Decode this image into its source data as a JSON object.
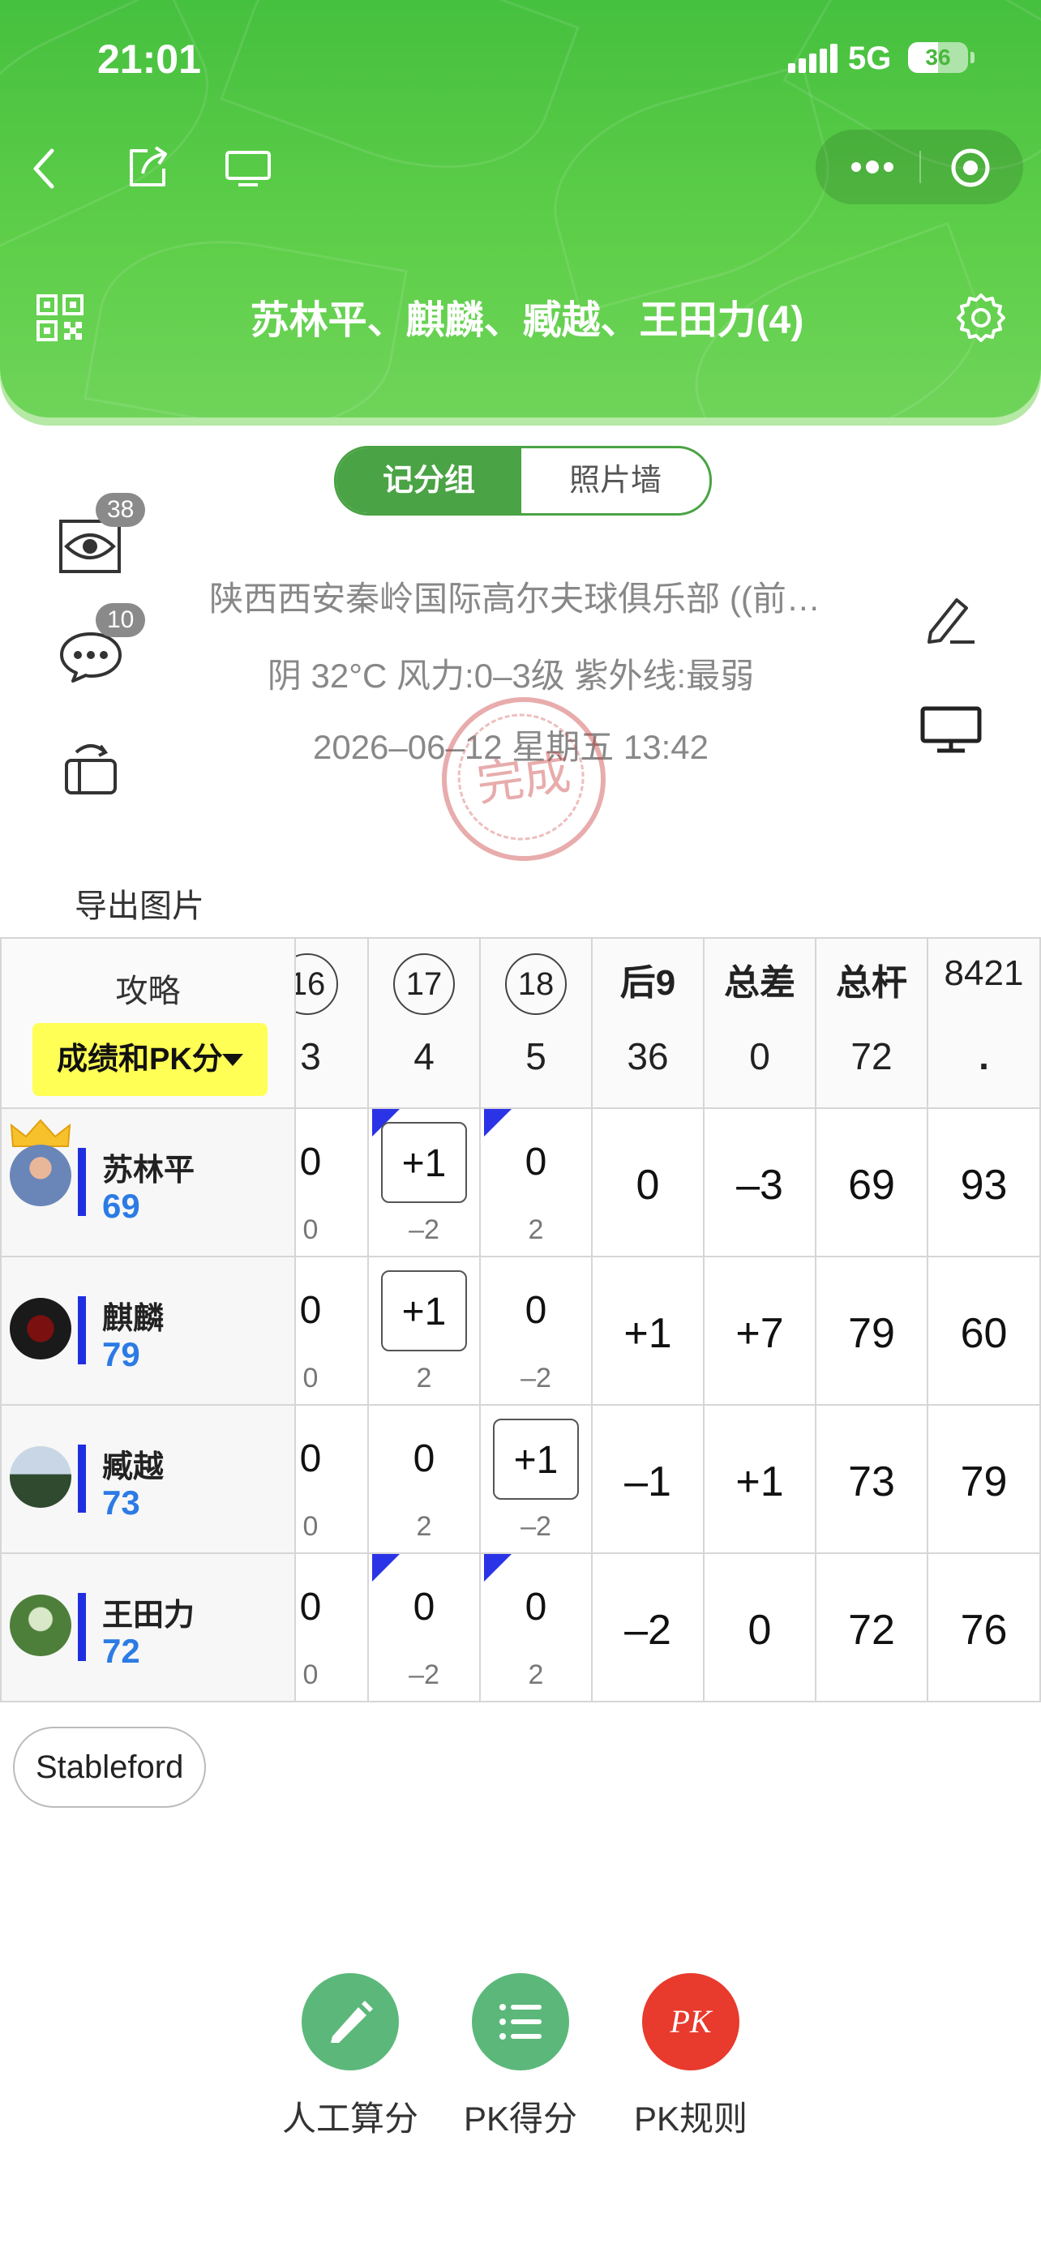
{
  "status": {
    "time": "21:01",
    "network": "5G",
    "battery": "36"
  },
  "nav": {
    "back_icon": "chevron-left-icon",
    "share_icon": "share-icon",
    "screen_icon": "monitor-icon",
    "more_icon": "more-dots-icon",
    "target_icon": "target-icon",
    "qr_icon": "qr-code-icon",
    "settings_icon": "gear-icon",
    "title": "苏林平、麒麟、臧越、王田力(4)"
  },
  "tabs": {
    "active": "记分组",
    "inactive": "照片墙"
  },
  "side": {
    "views_badge": "38",
    "comments_badge": "10"
  },
  "info": {
    "club": "陕西西安秦岭国际高尔夫球俱乐部 ((前…",
    "weather": "阴 32°C 风力:0–3级 紫外线:最弱",
    "datetime": "2026–06–12 星期五 13:42",
    "stamp": "完成"
  },
  "export_label": "导出图片",
  "table": {
    "strategy_label": "攻略",
    "dropdown_label": "成绩和PK分",
    "holes": [
      {
        "num": "16",
        "par": "3"
      },
      {
        "num": "17",
        "par": "4"
      },
      {
        "num": "18",
        "par": "5"
      }
    ],
    "summary_headers": [
      {
        "label": "后9",
        "value": "36"
      },
      {
        "label": "总差",
        "value": "0"
      },
      {
        "label": "总杆",
        "value": "72"
      },
      {
        "label": "8421",
        "value": "."
      }
    ],
    "players": [
      {
        "name": "苏林平",
        "score": "69",
        "holes": [
          {
            "v": "0",
            "s": "0"
          },
          {
            "v": "+1",
            "s": "–2"
          },
          {
            "v": "0",
            "s": "2"
          }
        ],
        "back9": "0",
        "diff": "–3",
        "total": "69",
        "pts": "93"
      },
      {
        "name": "麒麟",
        "score": "79",
        "holes": [
          {
            "v": "0",
            "s": "0"
          },
          {
            "v": "+1",
            "s": "2"
          },
          {
            "v": "0",
            "s": "–2"
          }
        ],
        "back9": "+1",
        "diff": "+7",
        "total": "79",
        "pts": "60"
      },
      {
        "name": "臧越",
        "score": "73",
        "holes": [
          {
            "v": "0",
            "s": "0"
          },
          {
            "v": "0",
            "s": "2"
          },
          {
            "v": "+1",
            "s": "–2"
          }
        ],
        "back9": "–1",
        "diff": "+1",
        "total": "73",
        "pts": "79"
      },
      {
        "name": "王田力",
        "score": "72",
        "holes": [
          {
            "v": "0",
            "s": "0"
          },
          {
            "v": "0",
            "s": "–2"
          },
          {
            "v": "0",
            "s": "2"
          }
        ],
        "back9": "–2",
        "diff": "0",
        "total": "72",
        "pts": "76"
      }
    ]
  },
  "mode_pill": "Stableford",
  "actions": [
    {
      "label": "人工算分",
      "icon": "pencil-icon",
      "color": "#5cb87a"
    },
    {
      "label": "PK得分",
      "icon": "list-icon",
      "color": "#5cb87a"
    },
    {
      "label": "PK规则",
      "icon": "pk-icon",
      "icon_text": "PK",
      "color": "#e83a2d"
    }
  ]
}
